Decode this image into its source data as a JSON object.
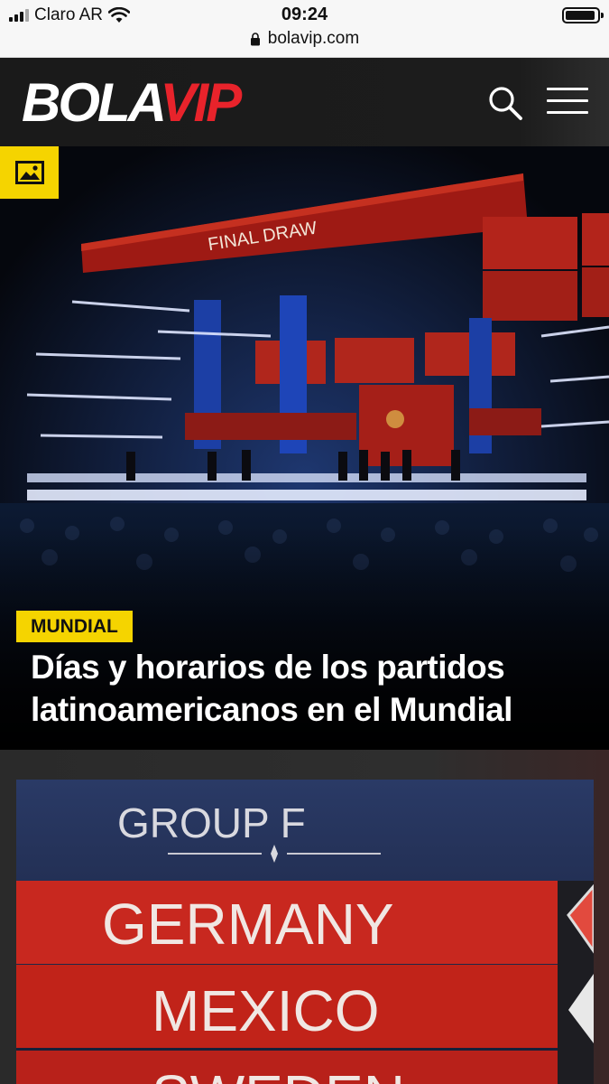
{
  "status_bar": {
    "carrier": "Claro AR",
    "time": "09:24",
    "battery_level": 0.95,
    "url": "bolavip.com"
  },
  "header": {
    "logo_part1": "BOLA",
    "logo_part2": "VIP",
    "search_icon": "search-icon",
    "menu_icon": "hamburger-menu-icon"
  },
  "hero": {
    "badge_icon": "image-gallery-icon",
    "tag": "MUNDIAL",
    "headline_line1": "Días y horarios de los partidos",
    "headline_line2": "latinoamericanos en el Mundial",
    "photo_banner_text": "FINAL DRAW"
  },
  "second_article": {
    "photo_group": "GROUP F",
    "photo_teams": [
      "GERMANY",
      "MEXICO",
      "SWEDEN"
    ]
  },
  "colors": {
    "accent_yellow": "#f5d400",
    "brand_red": "#e8232b",
    "header_bg": "#1c1c1c"
  }
}
